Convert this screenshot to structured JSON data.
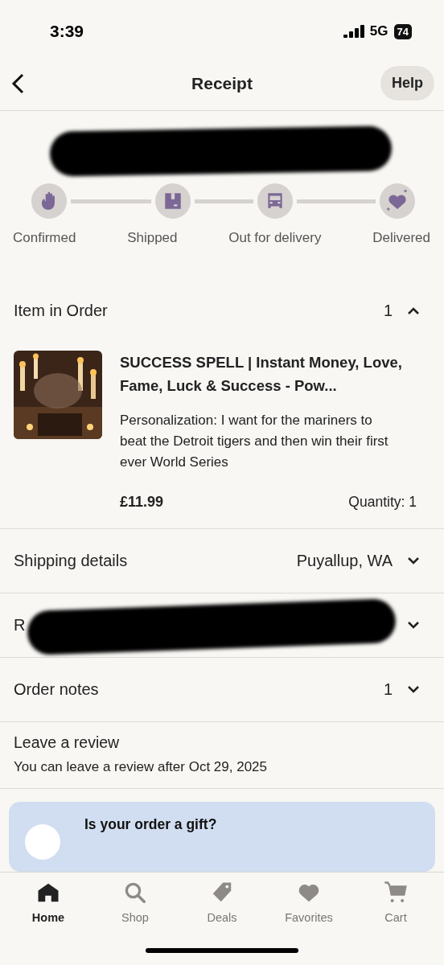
{
  "status_bar": {
    "time": "3:39",
    "network": "5G",
    "battery": "74"
  },
  "header": {
    "title": "Receipt",
    "help": "Help"
  },
  "tracker": {
    "steps": [
      {
        "kind": "hand",
        "label": "Confirmed"
      },
      {
        "kind": "box",
        "label": "Shipped"
      },
      {
        "kind": "car",
        "label": "Out for delivery"
      },
      {
        "kind": "heart",
        "label": "Delivered"
      }
    ]
  },
  "item_section": {
    "title": "Item in Order",
    "count": "1",
    "expanded": true,
    "item": {
      "title": "SUCCESS SPELL | Instant Money, Love, Fame, Luck & Success - Pow...",
      "personalization": "Personalization: I want for the mariners to beat the Detroit tigers and then win their first ever World Series",
      "price": "£11.99",
      "quantity": "Quantity: 1"
    }
  },
  "rows": [
    {
      "kind": "plain",
      "title": "Shipping details",
      "value": "Puyallup, WA",
      "expanded": false
    },
    {
      "kind": "redacted",
      "title": "R",
      "expanded": false
    },
    {
      "kind": "plain",
      "title": "Order notes",
      "value": "1",
      "expanded": false
    }
  ],
  "review": {
    "title": "Leave a review",
    "text": "You can leave a review after Oct 29, 2025"
  },
  "gift_banner": {
    "title": "Is your order a gift?"
  },
  "tab_bar": [
    {
      "kind": "home",
      "label": "Home",
      "selected": true
    },
    {
      "kind": "search",
      "label": "Shop",
      "selected": false
    },
    {
      "kind": "tag",
      "label": "Deals",
      "selected": false
    },
    {
      "kind": "heart",
      "label": "Favorites",
      "selected": false
    },
    {
      "kind": "cart",
      "label": "Cart",
      "selected": false
    }
  ]
}
